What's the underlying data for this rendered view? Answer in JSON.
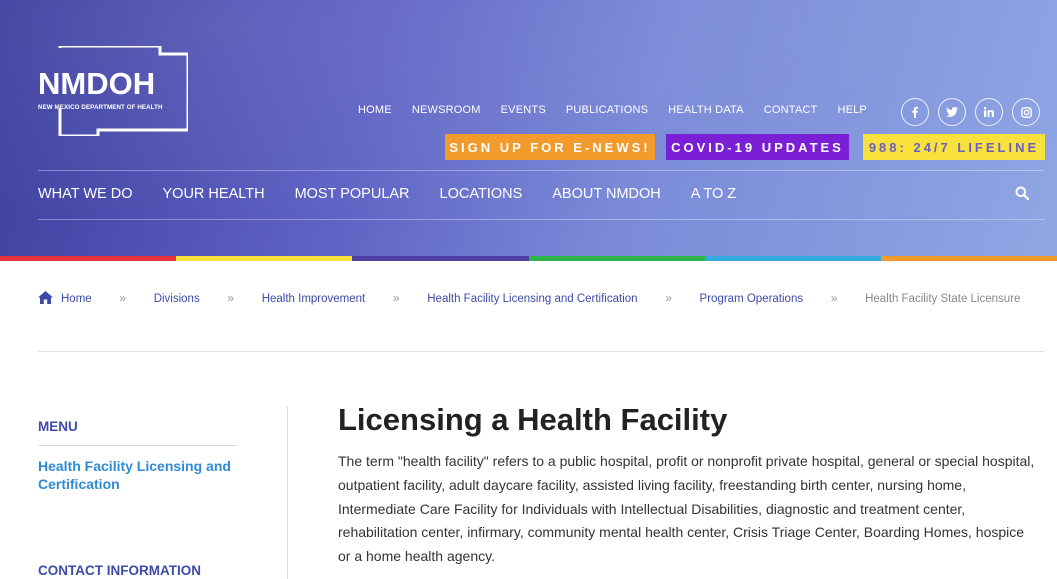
{
  "logo": {
    "name": "NMDOH",
    "subtitle": "NEW MEXICO DEPARTMENT OF HEALTH"
  },
  "top_nav": [
    "HOME",
    "NEWSROOM",
    "EVENTS",
    "PUBLICATIONS",
    "HEALTH DATA",
    "CONTACT",
    "HELP"
  ],
  "social": {
    "facebook": "f",
    "twitter": "t",
    "linkedin": "in",
    "instagram": "ig"
  },
  "cta": {
    "enews": "SIGN UP FOR E-NEWS!",
    "covid": "COVID-19 UPDATES",
    "lifeline": "988: 24/7 LIFELINE"
  },
  "main_nav": [
    "WHAT WE DO",
    "YOUR HEALTH",
    "MOST POPULAR",
    "LOCATIONS",
    "ABOUT NMDOH",
    "A TO Z"
  ],
  "rainbow_colors": [
    "#e8343c",
    "#f7e13a",
    "#4b3fa6",
    "#2fb34a",
    "#35a9e0",
    "#f39a2c"
  ],
  "breadcrumb": {
    "items": [
      "Home",
      "Divisions",
      "Health Improvement",
      "Health Facility Licensing and Certification",
      "Program Operations"
    ],
    "current": "Health Facility State Licensure",
    "separator": "»"
  },
  "sidebar": {
    "menu_title": "MENU",
    "link": "Health Facility Licensing and Certification",
    "contact_title": "CONTACT INFORMATION"
  },
  "content": {
    "title": "Licensing a Health Facility",
    "paragraph": "The term \"health facility\" refers to a public hospital, profit or nonprofit private hospital, general or special hospital, outpatient facility, adult daycare facility, assisted living facility, freestanding birth center, nursing home, Intermediate Care Facility for Individuals with Intellectual Disabilities, diagnostic and treatment center, rehabilitation center, infirmary, community mental health center, Crisis Triage Center, Boarding Homes, hospice or a home health agency."
  },
  "colors": {
    "accent_blue": "#3d4ba8",
    "link_blue": "#2f8bd6",
    "enews_orange": "#f39a2c",
    "covid_purple": "#7b1fd6",
    "lifeline_yellow": "#f7e13a"
  }
}
